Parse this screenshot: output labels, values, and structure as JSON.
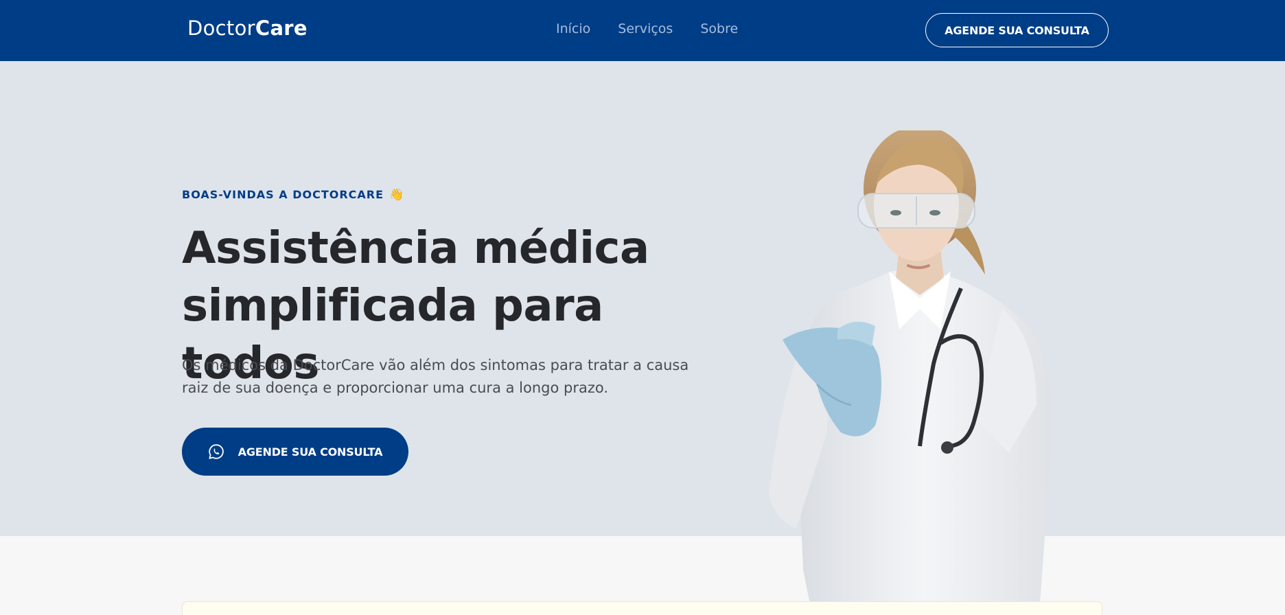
{
  "nav": {
    "logo_regular": "Doctor",
    "logo_bold": "Care",
    "links": [
      "Início",
      "Serviços",
      "Sobre"
    ],
    "cta_label": "AGENDE SUA CONSULTA"
  },
  "hero": {
    "eyebrow": "BOAS-VINDAS A DOCTORCARE",
    "eyebrow_emoji": "👋",
    "headline_line1": "Assistência médica",
    "headline_line2": "simplificada para todos",
    "lead_line1": "Os médicos da DoctorCare vão além dos sintomas para tratar a causa",
    "lead_line2": "raiz de sua doença e proporcionar uma cura a longo prazo.",
    "cta_label": "AGENDE SUA CONSULTA",
    "cta_icon": "whatsapp-icon"
  },
  "colors": {
    "brand": "#003d87",
    "hero_bg": "#dfe4eb",
    "page_bg": "#f6f7f6",
    "headline": "#26272b",
    "card_bg": "#fffdf0"
  }
}
